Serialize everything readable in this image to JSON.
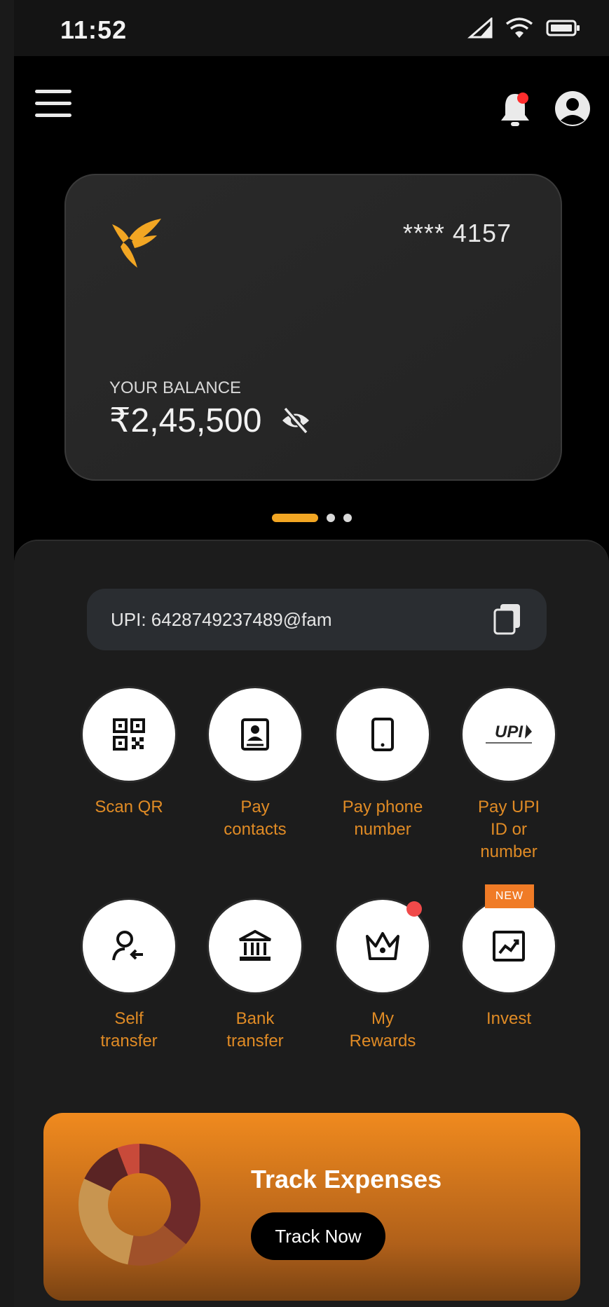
{
  "status_bar": {
    "time": "11:52"
  },
  "card": {
    "masked_number": "**** 4157",
    "balance_label": "YOUR BALANCE",
    "balance_amount": "₹2,45,500",
    "logo_color": "#f2a623"
  },
  "pager": {
    "total": 3,
    "active_index": 0
  },
  "upi": {
    "id_text": "UPI: 6428749237489@fam"
  },
  "actions": [
    {
      "label_line1": "Scan QR",
      "label_line2": "",
      "label_line3": "",
      "icon": "qr-code-icon"
    },
    {
      "label_line1": "Pay",
      "label_line2": "contacts",
      "label_line3": "",
      "icon": "contacts-book-icon"
    },
    {
      "label_line1": "Pay phone",
      "label_line2": "number",
      "label_line3": "",
      "icon": "phone-icon"
    },
    {
      "label_line1": "Pay UPI",
      "label_line2": "ID or",
      "label_line3": "number",
      "icon": "upi-logo-icon",
      "upi_logo_text": "UPI"
    },
    {
      "label_line1": "Self",
      "label_line2": "transfer",
      "label_line3": "",
      "icon": "self-transfer-icon"
    },
    {
      "label_line1": "Bank",
      "label_line2": "transfer",
      "label_line3": "",
      "icon": "bank-icon"
    },
    {
      "label_line1": "My",
      "label_line2": "Rewards",
      "label_line3": "",
      "icon": "crown-icon"
    },
    {
      "label_line1": "Invest",
      "label_line2": "",
      "label_line3": "",
      "icon": "chart-up-icon",
      "badge": "NEW"
    }
  ],
  "banner": {
    "title": "Track Expenses",
    "button_label": "Track Now"
  },
  "colors": {
    "accent": "#e08b25",
    "pager_active": "#f2a623",
    "notification_dot": "#ff2d2d",
    "banner_top": "#f08a1e"
  }
}
